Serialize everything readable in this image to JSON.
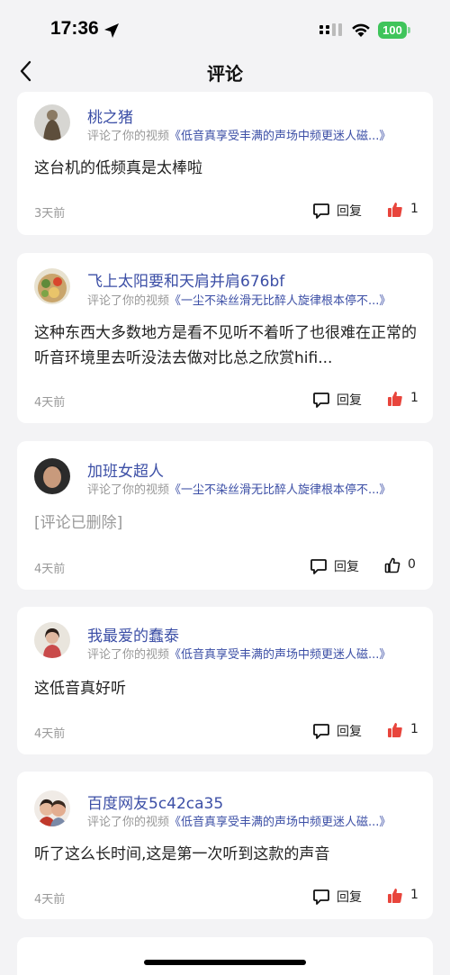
{
  "status": {
    "time": "17:36",
    "battery": "100"
  },
  "nav": {
    "title": "评论"
  },
  "comments": [
    {
      "username": "桃之猪",
      "ref_prefix": "评论了你的视频",
      "video_title": "《低音真享受丰满的声场中频更迷人磁...》",
      "text": "这台机的低频真是太棒啦",
      "time": "3天前",
      "reply_label": "回复",
      "likes": "1",
      "liked": true,
      "deleted": false
    },
    {
      "username": "飞上太阳要和天肩并肩676bf",
      "ref_prefix": "评论了你的视频",
      "video_title": "《一尘不染丝滑无比醉人旋律根本停不...》",
      "text": "这种东西大多数地方是看不见听不着听了也很难在正常的听音环境里去听没法去做对比总之欣赏hifi...",
      "time": "4天前",
      "reply_label": "回复",
      "likes": "1",
      "liked": true,
      "deleted": false
    },
    {
      "username": "加班女超人",
      "ref_prefix": "评论了你的视频",
      "video_title": "《一尘不染丝滑无比醉人旋律根本停不...》",
      "text": "[评论已删除]",
      "time": "4天前",
      "reply_label": "回复",
      "likes": "0",
      "liked": false,
      "deleted": true
    },
    {
      "username": "我最爱的蠢泰",
      "ref_prefix": "评论了你的视频",
      "video_title": "《低音真享受丰满的声场中频更迷人磁...》",
      "text": "这低音真好听",
      "time": "4天前",
      "reply_label": "回复",
      "likes": "1",
      "liked": true,
      "deleted": false
    },
    {
      "username": "百度网友5c42ca35",
      "ref_prefix": "评论了你的视频",
      "video_title": "《低音真享受丰满的声场中频更迷人磁...》",
      "text": "听了这么长时间,这是第一次听到这款的声音",
      "time": "4天前",
      "reply_label": "回复",
      "likes": "1",
      "liked": true,
      "deleted": false
    }
  ],
  "colors": {
    "accent": "#3c4fa6",
    "like_active": "#e8453c",
    "background": "#f3f3f5"
  }
}
